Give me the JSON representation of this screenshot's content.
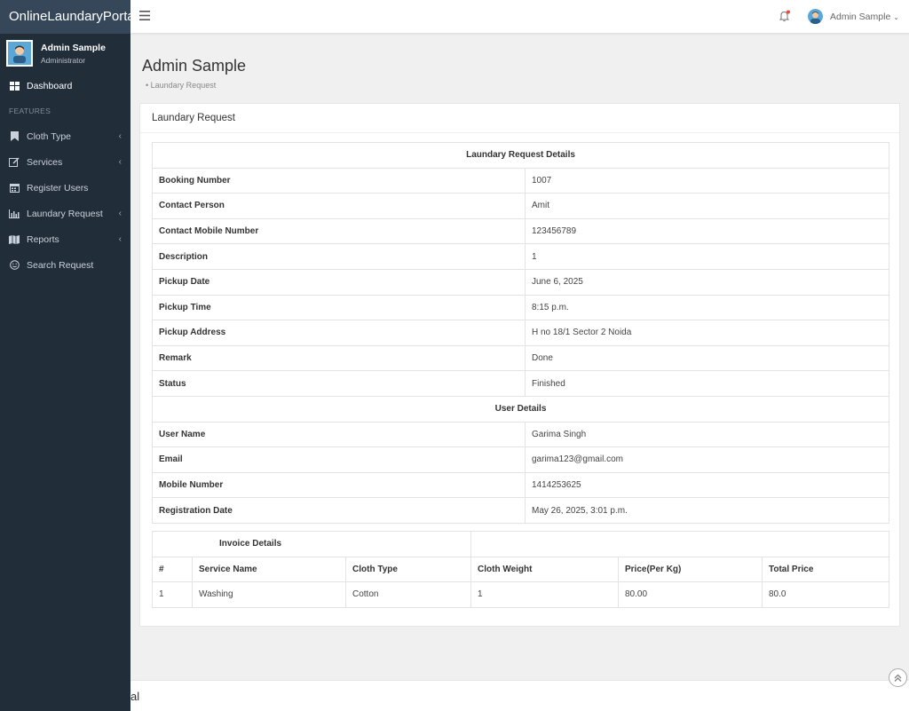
{
  "brand": "OnlineLaundaryPortal",
  "user": {
    "name": "Admin Sample",
    "role": "Administrator"
  },
  "nav": {
    "dashboard": "Dashboard",
    "features_header": "FEATURES",
    "cloth_type": "Cloth Type",
    "services": "Services",
    "register_users": "Register Users",
    "laundary_request": "Laundary Request",
    "reports": "Reports",
    "search_request": "Search Request"
  },
  "topbar": {
    "user_name": "Admin Sample",
    "notification_color": "#e74c3c"
  },
  "page": {
    "title": "Admin Sample",
    "breadcrumb": "Laundary Request"
  },
  "card": {
    "title": "Laundary Request"
  },
  "request_details": {
    "heading": "Laundary Request Details",
    "rows": [
      {
        "key": "Booking Number",
        "value": "1007"
      },
      {
        "key": "Contact Person",
        "value": "Amit"
      },
      {
        "key": "Contact Mobile Number",
        "value": "123456789"
      },
      {
        "key": "Description",
        "value": "1"
      },
      {
        "key": "Pickup Date",
        "value": "June 6, 2025"
      },
      {
        "key": "Pickup Time",
        "value": "8:15 p.m."
      },
      {
        "key": "Pickup Address",
        "value": "H no 18/1 Sector 2 Noida"
      },
      {
        "key": "Remark",
        "value": "Done"
      },
      {
        "key": "Status",
        "value": "Finished"
      }
    ]
  },
  "user_details": {
    "heading": "User Details",
    "rows": [
      {
        "key": "User Name",
        "value": "Garima Singh"
      },
      {
        "key": "Email",
        "value": "garima123@gmail.com"
      },
      {
        "key": "Mobile Number",
        "value": "1414253625"
      },
      {
        "key": "Registration Date",
        "value": "May 26, 2025, 3:01 p.m."
      }
    ]
  },
  "invoice": {
    "heading": "Invoice Details",
    "columns": [
      "#",
      "Service Name",
      "Cloth Type",
      "Cloth Weight",
      "Price(Per Kg)",
      "Total Price"
    ],
    "rows": [
      [
        "1",
        "Washing",
        "Cotton",
        "1",
        "80.00",
        "80.0"
      ]
    ]
  },
  "footer": {
    "text": "al"
  }
}
